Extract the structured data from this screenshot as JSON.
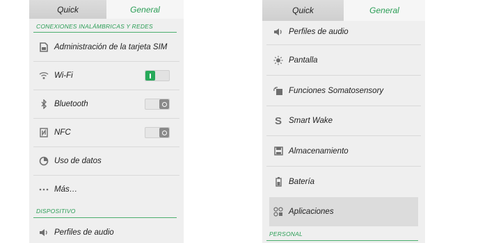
{
  "colors": {
    "accent": "#2a9d55",
    "switch_on": "#27a95a",
    "panel_bg": "#efefef"
  },
  "left": {
    "tabs": [
      {
        "label": "Quick",
        "active": false
      },
      {
        "label": "General",
        "active": true
      }
    ],
    "section_wireless": "CONEXIONES INALÁMBRICAS Y REDES",
    "items": [
      {
        "label": "Administración de la tarjeta SIM",
        "icon": "sim-card-icon"
      },
      {
        "label": "Wi-Fi",
        "icon": "wifi-icon",
        "switch": "on"
      },
      {
        "label": "Bluetooth",
        "icon": "bluetooth-icon",
        "switch": "off"
      },
      {
        "label": "NFC",
        "icon": "nfc-icon",
        "switch": "off"
      },
      {
        "label": "Uso de datos",
        "icon": "data-usage-icon"
      },
      {
        "label": "Más…",
        "icon": "more-icon"
      }
    ],
    "section_device": "DISPOSITIVO",
    "device_items": [
      {
        "label": "Perfiles de audio",
        "icon": "speaker-icon"
      }
    ]
  },
  "right": {
    "tabs": [
      {
        "label": "Quick",
        "active": false
      },
      {
        "label": "General",
        "active": true
      }
    ],
    "items": [
      {
        "label": "Perfiles de audio",
        "icon": "speaker-icon"
      },
      {
        "label": "Pantalla",
        "icon": "brightness-icon"
      },
      {
        "label": "Funciones Somatosensory",
        "icon": "gesture-icon"
      },
      {
        "label": "Smart Wake",
        "icon": "smart-wake-icon"
      },
      {
        "label": "Almacenamiento",
        "icon": "storage-icon"
      },
      {
        "label": "Batería",
        "icon": "battery-icon"
      },
      {
        "label": "Aplicaciones",
        "icon": "apps-icon",
        "highlighted": true
      }
    ],
    "section_personal": "PERSONAL"
  }
}
